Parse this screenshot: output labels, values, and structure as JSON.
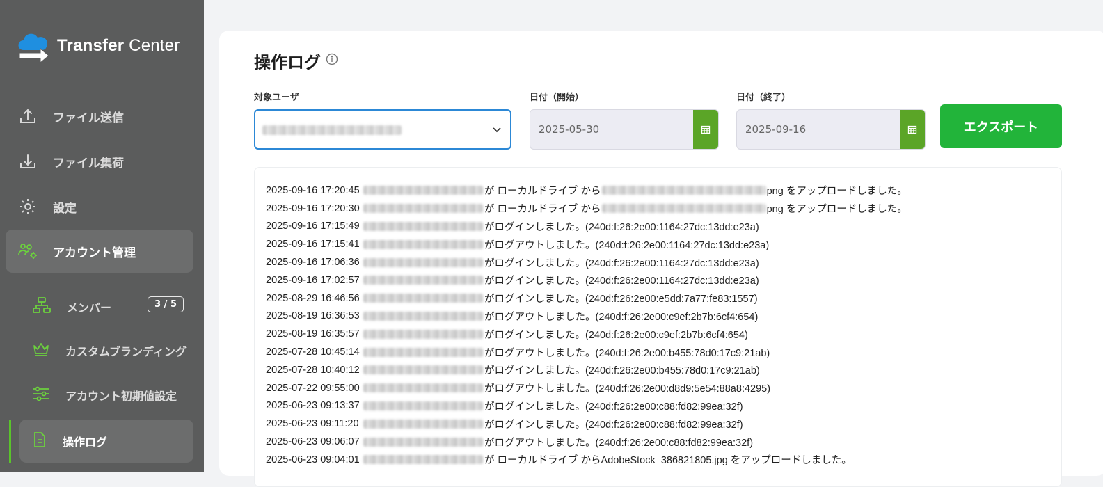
{
  "app": {
    "logo_text_1": "Transfer",
    "logo_text_2": " Center"
  },
  "sidebar": {
    "items": [
      {
        "label": "ファイル送信",
        "icon": "upload-icon"
      },
      {
        "label": "ファイル集荷",
        "icon": "download-icon"
      },
      {
        "label": "設定",
        "icon": "gear-icon"
      },
      {
        "label": "アカウント管理",
        "icon": "users-gear-icon"
      }
    ],
    "sub_items": [
      {
        "label": "メンバー",
        "icon": "org-chart-icon",
        "badge": "3 / 5"
      },
      {
        "label": "カスタムブランディング",
        "icon": "crown-icon"
      },
      {
        "label": "アカウント初期値設定",
        "icon": "sliders-icon"
      },
      {
        "label": "操作ログ",
        "icon": "document-icon"
      }
    ]
  },
  "main": {
    "title": "操作ログ",
    "filters": {
      "user_label": "対象ユーザ",
      "start_label": "日付（開始）",
      "start_value": "2025-05-30",
      "end_label": "日付（終了）",
      "end_value": "2025-09-16"
    },
    "export_label": "エクスポート",
    "log_rows": [
      {
        "ts": "2025-09-16 17:20:45",
        "pre": "が ローカルドライブ から",
        "file_blur": true,
        "post": "png をアップロードしました。"
      },
      {
        "ts": "2025-09-16 17:20:30",
        "pre": "が ローカルドライブ から",
        "file_blur": true,
        "post": "png をアップロードしました。"
      },
      {
        "ts": "2025-09-16 17:15:49",
        "pre": "がログインしました。(240d:f:26:2e00:1164:27dc:13dd:e23a)"
      },
      {
        "ts": "2025-09-16 17:15:41",
        "pre": "がログアウトしました。(240d:f:26:2e00:1164:27dc:13dd:e23a)"
      },
      {
        "ts": "2025-09-16 17:06:36",
        "pre": "がログインしました。(240d:f:26:2e00:1164:27dc:13dd:e23a)"
      },
      {
        "ts": "2025-09-16 17:02:57",
        "pre": "がログインしました。(240d:f:26:2e00:1164:27dc:13dd:e23a)"
      },
      {
        "ts": "2025-08-29 16:46:56",
        "pre": "がログインしました。(240d:f:26:2e00:e5dd:7a77:fe83:1557)"
      },
      {
        "ts": "2025-08-19 16:36:53",
        "pre": "がログアウトしました。(240d:f:26:2e00:c9ef:2b7b:6cf4:654)"
      },
      {
        "ts": "2025-08-19 16:35:57",
        "pre": "がログインしました。(240d:f:26:2e00:c9ef:2b7b:6cf4:654)"
      },
      {
        "ts": "2025-07-28 10:45:14",
        "pre": "がログアウトしました。(240d:f:26:2e00:b455:78d0:17c9:21ab)"
      },
      {
        "ts": "2025-07-28 10:40:12",
        "pre": "がログインしました。(240d:f:26:2e00:b455:78d0:17c9:21ab)"
      },
      {
        "ts": "2025-07-22 09:55:00",
        "pre": "がログアウトしました。(240d:f:26:2e00:d8d9:5e54:88a8:4295)"
      },
      {
        "ts": "2025-06-23 09:13:37",
        "pre": "がログインしました。(240d:f:26:2e00:c88:fd82:99ea:32f)"
      },
      {
        "ts": "2025-06-23 09:11:20",
        "pre": "がログインしました。(240d:f:26:2e00:c88:fd82:99ea:32f)"
      },
      {
        "ts": "2025-06-23 09:06:07",
        "pre": "がログアウトしました。(240d:f:26:2e00:c88:fd82:99ea:32f)"
      },
      {
        "ts": "2025-06-23 09:04:01",
        "pre": "が ローカルドライブ からAdobeStock_386821805.jpg をアップロードしました。"
      }
    ]
  },
  "colors": {
    "sidebar_bg": "#5b5c5c",
    "accent_green": "#22b43a",
    "calendar_green": "#5ba527",
    "focus_blue": "#2c88d6"
  }
}
